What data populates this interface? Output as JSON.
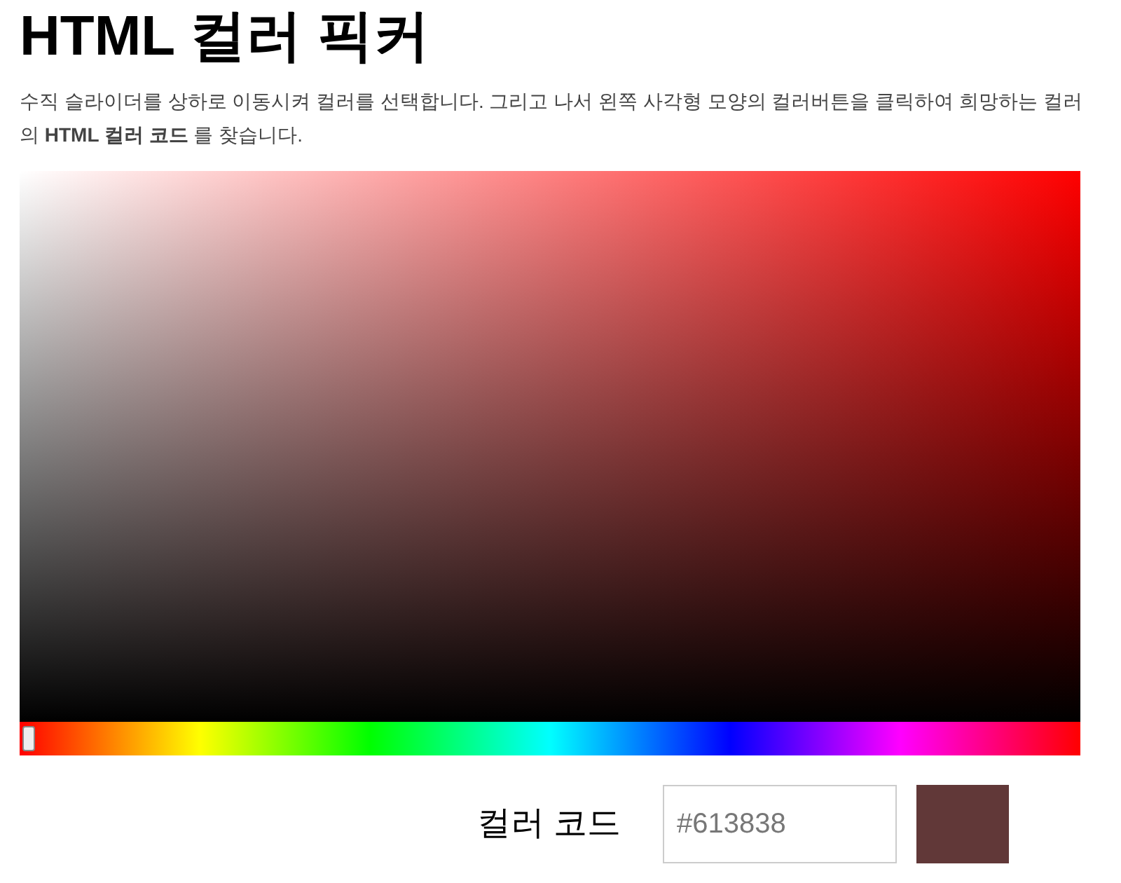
{
  "title": "HTML 컬러 픽커",
  "description": "수직 슬라이더를 상하로 이동시켜 컬러를 선택합니다. 그리고 나서 왼쪽 사각형 모양의 컬러버튼을 클릭하여 희망하는 컬러의 **HTML 컬러 코드** 를 찾습니다.",
  "hue_slider": {
    "level": 0
  },
  "color_code": {
    "label": "컬러 코드",
    "value": "#613838"
  },
  "swatch": {
    "color": "#613838"
  }
}
